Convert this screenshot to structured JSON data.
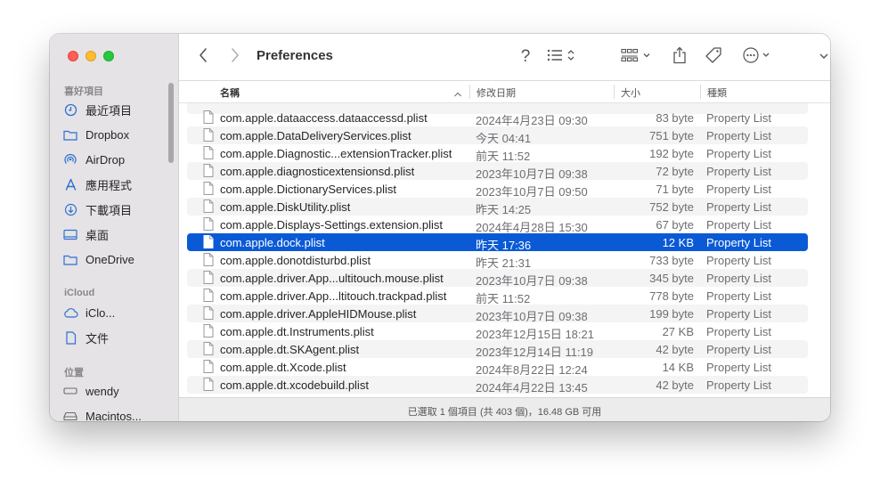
{
  "window": {
    "title": "Preferences"
  },
  "sidebar": {
    "favorites_header": "喜好項目",
    "icloud_header": "iCloud",
    "locations_header": "位置",
    "favorites": [
      {
        "label": "最近項目",
        "icon": "clock-icon"
      },
      {
        "label": "Dropbox",
        "icon": "folder-icon"
      },
      {
        "label": "AirDrop",
        "icon": "airdrop-icon"
      },
      {
        "label": "應用程式",
        "icon": "applications-icon"
      },
      {
        "label": "下載項目",
        "icon": "download-icon"
      },
      {
        "label": "桌面",
        "icon": "desktop-icon"
      },
      {
        "label": "OneDrive",
        "icon": "folder-icon"
      }
    ],
    "icloud": [
      {
        "label": "iClo...",
        "icon": "cloud-icon"
      },
      {
        "label": "文件",
        "icon": "document-icon"
      }
    ],
    "locations": [
      {
        "label": "wendy",
        "icon": "disk-icon"
      },
      {
        "label": "Macintos...",
        "icon": "harddrive-icon"
      }
    ]
  },
  "toolbar": {
    "back": "back-icon",
    "forward": "forward-icon",
    "help_glyph": "?",
    "list_view": "list-view-icon",
    "group": "group-icon",
    "share": "share-icon",
    "tag": "tag-icon",
    "more": "more-icon",
    "expand": "chevron-down-icon",
    "search": "search-icon"
  },
  "columns": {
    "name": "名稱",
    "date": "修改日期",
    "size": "大小",
    "kind": "種類"
  },
  "files": [
    {
      "name": "com.apple.dataaccess.dataaccessd.plist",
      "date": "2024年4月23日 09:30",
      "size": "83 byte",
      "kind": "Property List"
    },
    {
      "name": "com.apple.DataDeliveryServices.plist",
      "date": "今天 04:41",
      "size": "751 byte",
      "kind": "Property List"
    },
    {
      "name": "com.apple.Diagnostic...extensionTracker.plist",
      "date": "前天 11:52",
      "size": "192 byte",
      "kind": "Property List"
    },
    {
      "name": "com.apple.diagnosticextensionsd.plist",
      "date": "2023年10月7日 09:38",
      "size": "72 byte",
      "kind": "Property List"
    },
    {
      "name": "com.apple.DictionaryServices.plist",
      "date": "2023年10月7日 09:50",
      "size": "71 byte",
      "kind": "Property List"
    },
    {
      "name": "com.apple.DiskUtility.plist",
      "date": "昨天 14:25",
      "size": "752 byte",
      "kind": "Property List"
    },
    {
      "name": "com.apple.Displays-Settings.extension.plist",
      "date": "2024年4月28日 15:30",
      "size": "67 byte",
      "kind": "Property List"
    },
    {
      "name": "com.apple.dock.plist",
      "date": "昨天 17:36",
      "size": "12 KB",
      "kind": "Property List",
      "selected": true
    },
    {
      "name": "com.apple.donotdisturbd.plist",
      "date": "昨天 21:31",
      "size": "733 byte",
      "kind": "Property List"
    },
    {
      "name": "com.apple.driver.App...ultitouch.mouse.plist",
      "date": "2023年10月7日 09:38",
      "size": "345 byte",
      "kind": "Property List"
    },
    {
      "name": "com.apple.driver.App...ltitouch.trackpad.plist",
      "date": "前天 11:52",
      "size": "778 byte",
      "kind": "Property List"
    },
    {
      "name": "com.apple.driver.AppleHIDMouse.plist",
      "date": "2023年10月7日 09:38",
      "size": "199 byte",
      "kind": "Property List"
    },
    {
      "name": "com.apple.dt.Instruments.plist",
      "date": "2023年12月15日 18:21",
      "size": "27 KB",
      "kind": "Property List"
    },
    {
      "name": "com.apple.dt.SKAgent.plist",
      "date": "2023年12月14日 11:19",
      "size": "42 byte",
      "kind": "Property List"
    },
    {
      "name": "com.apple.dt.Xcode.plist",
      "date": "2024年8月22日 12:24",
      "size": "14 KB",
      "kind": "Property List"
    },
    {
      "name": "com.apple.dt.xcodebuild.plist",
      "date": "2024年4月22日 13:45",
      "size": "42 byte",
      "kind": "Property List"
    }
  ],
  "status": {
    "text": "已選取 1 個項目 (共 403 個)，16.48 GB 可用"
  },
  "colors": {
    "selection": "#0a5ad6",
    "sidebar_bg": "#e5e3e6",
    "accent_icon": "#2f6fd1"
  }
}
